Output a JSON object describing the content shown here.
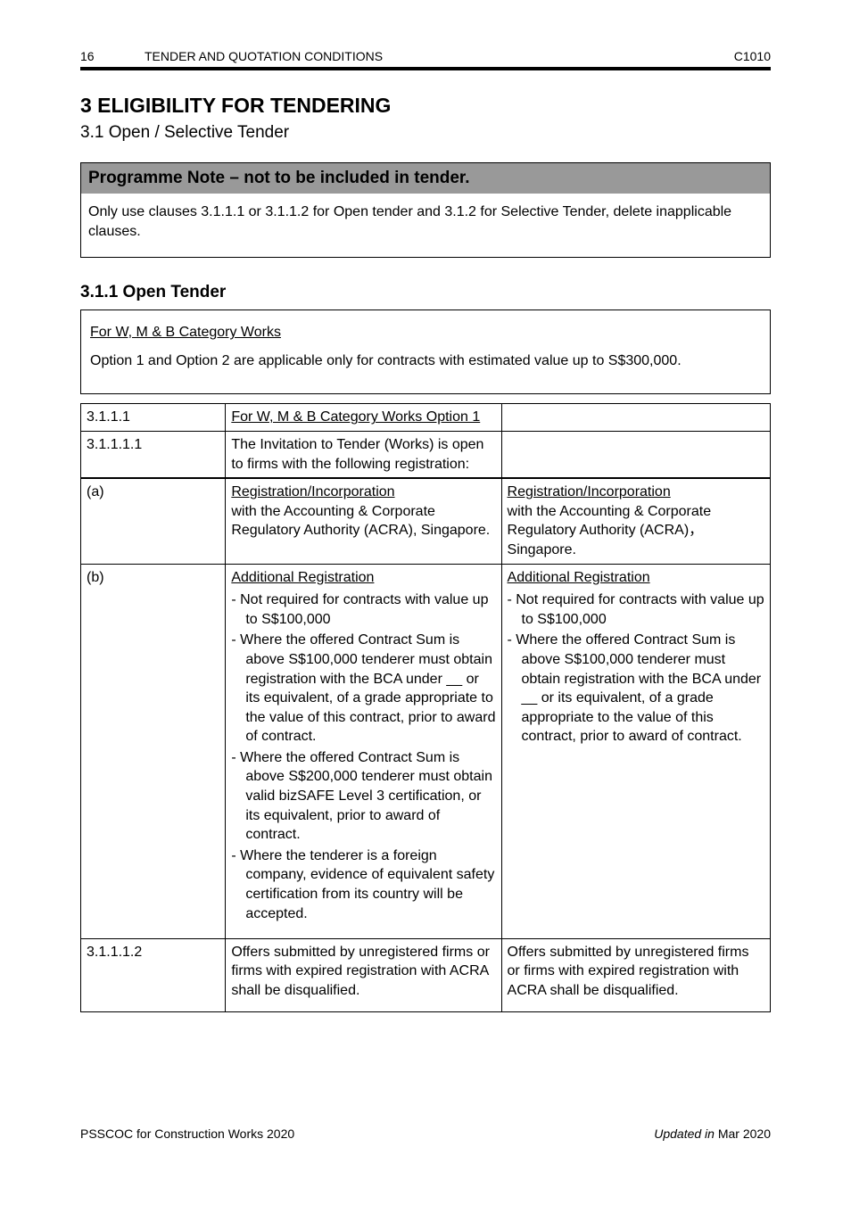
{
  "header": {
    "page_label": "16",
    "section_label": "TENDER AND QUOTATION CONDITIONS",
    "code": "C1010"
  },
  "title": "3  ELIGIBILITY FOR TENDERING",
  "subtitle": "3.1  Open / Selective Tender",
  "programme_note": {
    "heading": "Programme Note – not to be included in tender.",
    "body": "Only use clauses 3.1.1.1 or 3.1.1.2 for Open tender and 3.1.2 for Selective Tender, delete inapplicable clauses."
  },
  "section_title": "3.1.1 Open Tender",
  "note": {
    "line1": "For W, M & B Category Works",
    "line2": "Option 1 and Option 2 are applicable only for contracts with estimated value up to S$300,000."
  },
  "table": {
    "rows": [
      {
        "c0": "3.1.1.1",
        "c1": "For W, M & B Category Works Option 1",
        "c2": ""
      },
      {
        "c0": "3.1.1.1.1",
        "c1": "The Invitation to Tender (Works) is open to firms with the following registration:",
        "c2": ""
      },
      {
        "c0": "",
        "c1_label": "Registration/Incorporation",
        "c1_body": "with the Accounting & Corporate Regulatory Authority (ACRA), Singapore.",
        "c2_label": "Registration/Incorporation",
        "c2_body": "with the Accounting & Corporate Regulatory Authority (ACRA)，Singapore."
      },
      {
        "c0": "",
        "c1_label": "Additional Registration",
        "c1_bullets": [
          "Not required for contracts with value up to S$100,000",
          "Where the offered Contract Sum is above S$100,000 tenderer must obtain registration with the BCA under __ or its equivalent, of a grade appropriate to the value of this contract, prior to award of contract.",
          "Where the offered Contract Sum is above S$200,000 tenderer must obtain valid bizSAFE Level 3 certification, or its equivalent, prior to award of contract.",
          "Where the tenderer is a foreign company, evidence of equivalent safety certification from its country will be accepted."
        ],
        "c2_label": "Additional Registration",
        "c2_bullets": [
          "Not required for contracts with value up to S$100,000",
          "Where the offered Contract Sum is above S$100,000 tenderer must obtain registration with the BCA under __ or its equivalent, of a grade appropriate to the value of this contract, prior to award of contract."
        ]
      },
      {
        "c0": "3.1.1.1.2",
        "c1": "Offers submitted by unregistered firms or firms with expired registration with ACRA shall be disqualified.",
        "c2": "Offers submitted by unregistered firms or firms with expired registration with ACRA shall be disqualified."
      }
    ]
  },
  "footer": {
    "left": "PSSCOC for Construction Works 2020",
    "right_label": "Updated in",
    "right_date": "Mar 2020"
  }
}
